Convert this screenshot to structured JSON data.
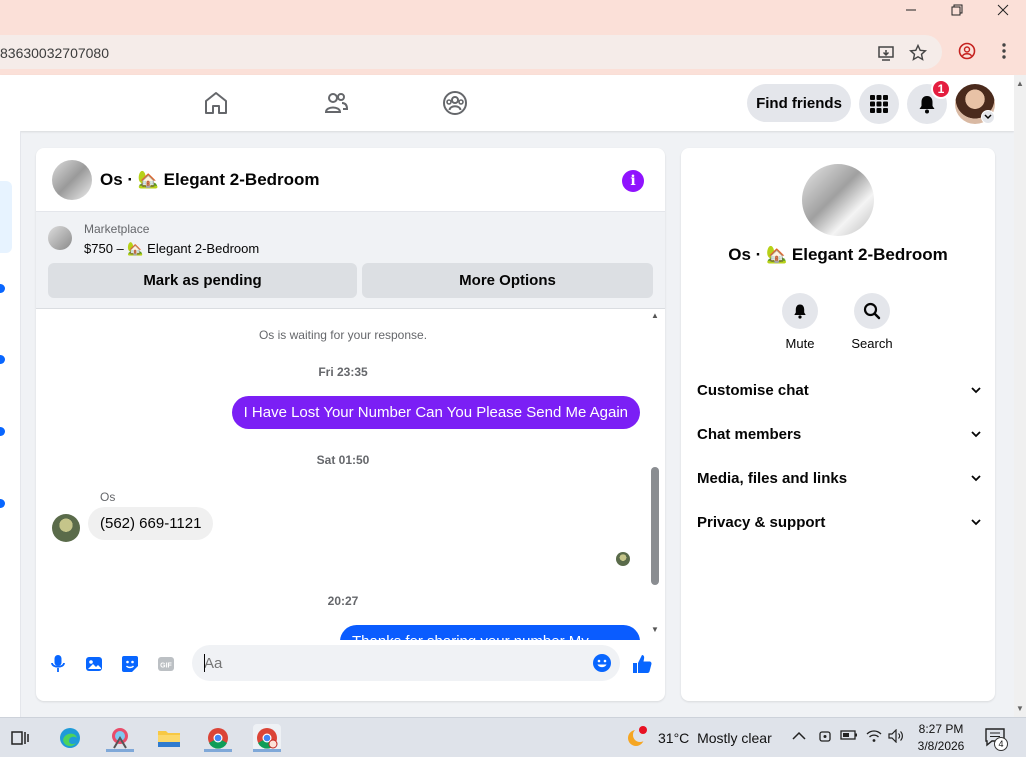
{
  "browser": {
    "url_fragment": "83630032707080"
  },
  "topnav": {
    "find_friends": "Find friends",
    "notification_count": "1"
  },
  "chat": {
    "title": "Os · 🏡 Elegant 2-Bedroom",
    "info_glyph": "i",
    "marketplace": {
      "label": "Marketplace",
      "listing": "$750 – 🏡 Elegant 2-Bedroom",
      "mark_pending": "Mark as pending",
      "more_options": "More Options"
    },
    "messages": {
      "waiting": "Os is waiting for your response.",
      "ts1": "Fri 23:35",
      "out1": "I Have Lost Your Number Can You Please Send Me Again",
      "ts2": "Sat 01:50",
      "sender": "Os",
      "in1": "(562) 669-1121",
      "ts3": "20:27",
      "out2": "Thanks for sharing your number My..."
    },
    "composer": {
      "placeholder": "Aa"
    }
  },
  "info_panel": {
    "title": "Os · 🏡 Elegant 2-Bedroom",
    "actions": {
      "mute": "Mute",
      "search": "Search"
    },
    "sections": [
      "Customise chat",
      "Chat members",
      "Media, files and links",
      "Privacy & support"
    ]
  },
  "taskbar": {
    "weather_temp": "31°C",
    "weather_desc": "Mostly clear",
    "time": "8:27 PM",
    "date": "3/8/2026",
    "notification_count": "4"
  },
  "colors": {
    "accent_purple": "#7b1ff5",
    "accent_blue": "#0a5cff",
    "fb_blue": "#0866ff",
    "badge_red": "#e41e3f"
  }
}
